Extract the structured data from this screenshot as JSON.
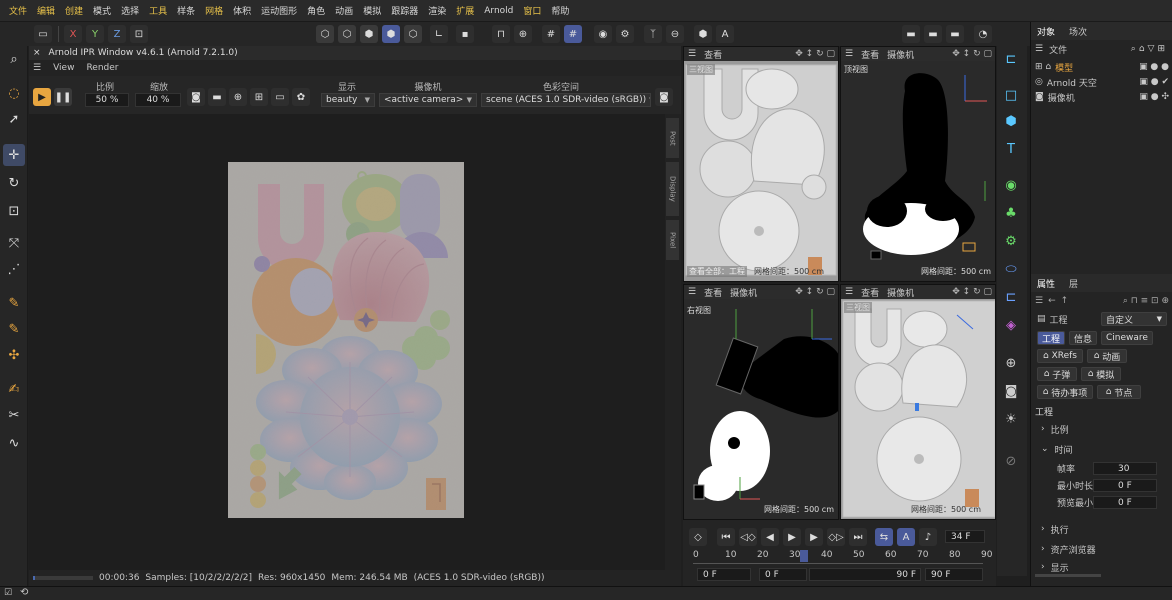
{
  "menu": [
    "文件",
    "编辑",
    "创建",
    "模式",
    "选择",
    "工具",
    "样条",
    "网格",
    "体积",
    "运动图形",
    "角色",
    "动画",
    "模拟",
    "跟踪器",
    "渲染",
    "扩展",
    "Arnold",
    "窗口",
    "帮助"
  ],
  "menu_highlight": [
    0,
    1,
    2,
    5,
    7,
    15,
    17
  ],
  "toolbar": {
    "axis_x": "X",
    "axis_y": "Y",
    "axis_z": "Z"
  },
  "ipr": {
    "title": "Arnold IPR Window v4.6.1 (Arnold 7.2.1.0)",
    "menu_view": "View",
    "menu_render": "Render",
    "ratio_label": "比例",
    "ratio_value": "50 %",
    "zoom_label": "缩放",
    "zoom_value": "40 %",
    "display_label": "显示",
    "display_value": "beauty",
    "camera_label": "摄像机",
    "camera_value": "<active camera>",
    "colorspace_label": "色彩空间",
    "colorspace_value": "scene (ACES 1.0 SDR-video (sRGB))",
    "side_tabs": [
      "Post",
      "Display",
      "Pixel"
    ],
    "status_time": "00:00:36",
    "status_samples": "Samples: [10/2/2/2/2/2]",
    "status_res": "Res: 960x1450",
    "status_mem": "Mem: 246.54 MB",
    "status_cs": "(ACES 1.0 SDR-video (sRGB))"
  },
  "viewports": {
    "tl": {
      "menu1": "查看",
      "overlay_top": "三视图",
      "overlay_bottom": "查看全部：工程",
      "grid": "网格间距：500 cm"
    },
    "tr": {
      "menu1": "查看",
      "menu2": "摄像机",
      "name": "顶视图",
      "grid": "网格间距：500 cm"
    },
    "bl": {
      "menu1": "查看",
      "menu2": "摄像机",
      "name": "右视图",
      "grid": "网格间距：500 cm"
    },
    "br": {
      "menu1": "查看",
      "menu2": "摄像机",
      "name": "三视图",
      "grid": "网格间距：500 cm"
    }
  },
  "timeline": {
    "frame_current": "34 F",
    "ticks": [
      "0",
      "10",
      "20",
      "30",
      "40",
      "50",
      "60",
      "70",
      "80",
      "90"
    ],
    "marker": "34",
    "start": "0 F",
    "start2": "0 F",
    "end": "90 F",
    "end2": "90 F"
  },
  "objects": {
    "tab_objects": "对象",
    "tab_takes": "场次",
    "menu_file": "文件",
    "items": [
      {
        "label": "模型",
        "color": "#e8a640"
      },
      {
        "label": "Arnold 天空",
        "color": "#c8c8c8"
      },
      {
        "label": "摄像机",
        "color": "#c8c8c8"
      }
    ]
  },
  "attributes": {
    "tab_attr": "属性",
    "tab_layer": "层",
    "mode_label": "工程",
    "mode_value": "自定义",
    "tabs_row1": [
      "工程",
      "信息",
      "Cineware"
    ],
    "tabs_row2": [
      "XRefs",
      "动画"
    ],
    "tabs_row3": [
      "子弹",
      "模拟"
    ],
    "tabs_row4": [
      "待办事项",
      "节点"
    ],
    "section": "工程",
    "group_scale": "比例",
    "group_time": "时间",
    "fps_label": "帧率",
    "fps_value": "30",
    "min_label": "最小时长",
    "min_value": "0 F",
    "preview_label": "预览最小",
    "preview_value": "0 F",
    "group_exec": "执行",
    "group_asset": "资产浏览器",
    "group_more": "显示"
  },
  "colors": {
    "accent": "#4a5a9a",
    "highlight_text": "#e8c24a",
    "render_bg": "#d9d2cd"
  }
}
